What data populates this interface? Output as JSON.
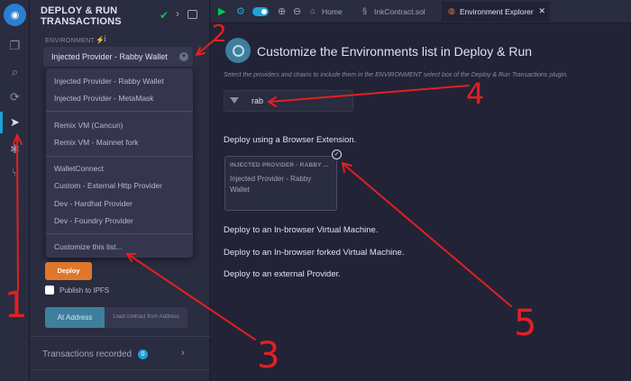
{
  "icon_bar": {
    "icons": [
      "remix-logo-icon",
      "file-explorer-icon",
      "search-icon",
      "solidity-compiler-icon",
      "deploy-run-icon",
      "debugger-icon",
      "git-icon"
    ]
  },
  "side_panel": {
    "title": "DEPLOY & RUN TRANSACTIONS",
    "environment_label": "ENVIRONMENT",
    "info_glyph": "i",
    "selected_environment": "Injected Provider - Rabby Wallet",
    "dropdown_groups": [
      [
        "Injected Provider - Rabby Wallet",
        "Injected Provider - MetaMask"
      ],
      [
        "Remix VM (Cancun)",
        "Remix VM - Mainnet fork"
      ],
      [
        "WalletConnect",
        "Custom - External Http Provider",
        "Dev - Hardhat Provider",
        "Dev - Foundry Provider"
      ],
      [
        "Customize this list..."
      ]
    ],
    "deploy_label": "Deploy",
    "publish_ipfs_label": "Publish to IPFS",
    "at_address_label": "At Address",
    "load_contract_label": "Load contract from Address",
    "transactions_label": "Transactions recorded",
    "transactions_count": "0"
  },
  "tabbar": {
    "tabs": [
      {
        "label": "Home",
        "icon": "home-icon"
      },
      {
        "label": "InkContract.sol",
        "icon": "file-icon"
      },
      {
        "label": "Environment Explorer",
        "icon": "environment-icon"
      }
    ],
    "close_glyph": "✕"
  },
  "main": {
    "title": "Customize the Environments list in Deploy & Run",
    "subtitle": "Select the providers and chains to include them in the ENVIRONMENT select box of the Deploy & Run Transactions plugin.",
    "filter_value": "rab",
    "section_browser_extension": "Deploy using a Browser Extension.",
    "card": {
      "header": "INJECTED PROVIDER - RABBY ...",
      "body": "Injected Provider - Rabby Wallet"
    },
    "section_in_browser_vm": "Deploy to an In-browser Virtual Machine.",
    "section_forked_vm": "Deploy to an In-browser forked Virtual Machine.",
    "section_external": "Deploy to an external Provider."
  },
  "annotations": [
    "1",
    "2",
    "3",
    "4",
    "5"
  ],
  "colors": {
    "accent": "#1ea2d8",
    "deploy": "#e0772b",
    "annotation": "#e32020",
    "success": "#00c853"
  }
}
